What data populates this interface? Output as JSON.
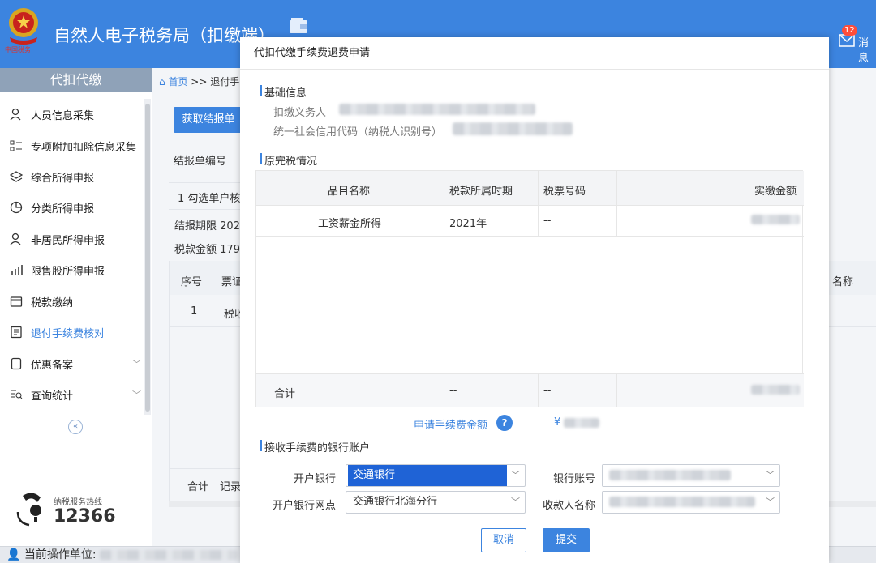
{
  "header": {
    "title": "自然人电子税务局（扣缴端）",
    "mail_count": "12",
    "mail_label": "消息",
    "brand_color": "#3c84df"
  },
  "sidebar": {
    "title": "代扣代缴",
    "items": [
      {
        "label": "人员信息采集",
        "icon": "person-icon"
      },
      {
        "label": "专项附加扣除信息采集",
        "icon": "list-icon"
      },
      {
        "label": "综合所得申报",
        "icon": "layers-icon"
      },
      {
        "label": "分类所得申报",
        "icon": "pie-chart-icon"
      },
      {
        "label": "非居民所得申报",
        "icon": "person-icon"
      },
      {
        "label": "限售股所得申报",
        "icon": "bar-chart-icon"
      },
      {
        "label": "税款缴纳",
        "icon": "folder-icon"
      },
      {
        "label": "退付手续费核对",
        "icon": "document-icon"
      },
      {
        "label": "优惠备案",
        "icon": "file-icon"
      },
      {
        "label": "查询统计",
        "icon": "search-list-icon"
      }
    ],
    "active_index": 7,
    "hotline_label": "纳税服务热线",
    "hotline_number": "12366"
  },
  "background": {
    "breadcrumb_home": "首页",
    "breadcrumb_sep": ">>",
    "breadcrumb_current": "退付手",
    "fetch_button": "获取结报单",
    "report_no_label": "结报单编号",
    "step_text": "1 勾选单户核",
    "period_label": "结报期限",
    "period_value": "202",
    "tax_amount_label": "税款金额",
    "tax_amount_value": "179",
    "col_seq": "序号",
    "col_ticket": "票证",
    "col_name_right": "名称",
    "row_seq": "1",
    "row_ticket": "税收",
    "total_label": "合计",
    "records_label": "记录"
  },
  "status_bar": {
    "label": "当前操作单位:"
  },
  "dialog": {
    "title": "代扣代缴手续费退费申请",
    "section_basic": "基础信息",
    "withholder_label": "扣缴义务人",
    "credit_code_label": "统一社会信用代码（纳税人识别号）",
    "section_original": "原完税情况",
    "table": {
      "headers": [
        "品目名称",
        "税款所属时期",
        "税票号码",
        "实缴金额"
      ],
      "rows": [
        [
          "工资薪金所得",
          "2021年",
          "--",
          ""
        ]
      ],
      "total": [
        "合计",
        "--",
        "--",
        ""
      ]
    },
    "apply_fee_label": "申请手续费金额",
    "help_icon_text": "?",
    "yen_symbol": "¥",
    "section_bank": "接收手续费的银行账户",
    "bank_label": "开户银行",
    "bank_value": "交通银行",
    "account_label": "银行账号",
    "branch_label": "开户银行网点",
    "branch_value": "交通银行北海分行",
    "payee_label": "收款人名称",
    "cancel_label": "取消",
    "submit_label": "提交"
  }
}
